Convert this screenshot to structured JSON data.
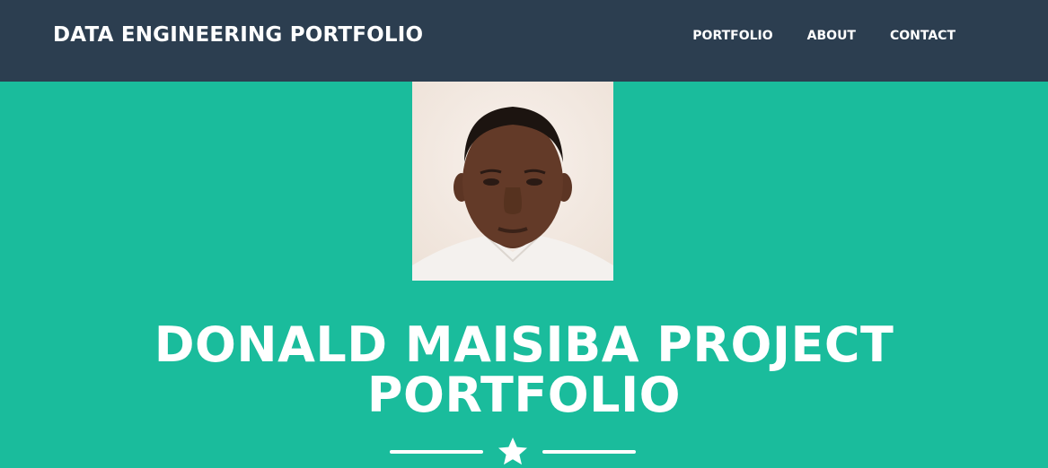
{
  "navbar": {
    "brand": "DATA ENGINEERING PORTFOLIO",
    "links": [
      {
        "label": "PORTFOLIO"
      },
      {
        "label": "ABOUT"
      },
      {
        "label": "CONTACT"
      }
    ]
  },
  "masthead": {
    "heading_line1": "DONALD MAISIBA PROJECT",
    "heading_line2": "PORTFOLIO",
    "divider_icon": "star-icon"
  },
  "colors": {
    "navbar_bg": "#2c3e50",
    "masthead_bg": "#1abc9c",
    "text": "#ffffff"
  }
}
